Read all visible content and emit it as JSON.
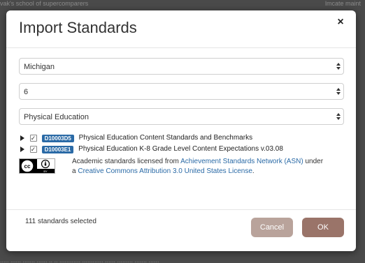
{
  "backdrop": {
    "top_left": "vak's school of supercomparers",
    "top_right": "lmcate maint",
    "bottom": "..... ...... ....... ...... .. .. ............ ............ ...... ......... ....... ......"
  },
  "modal": {
    "title": "Import Standards",
    "close_glyph": "×",
    "state_select": "Michigan",
    "grade_select": "6",
    "subject_select": "Physical Education",
    "standards": [
      {
        "code": "D10003D5",
        "label": "Physical Education Content Standards and Benchmarks",
        "checked": true
      },
      {
        "code": "D10003E1",
        "label": "Physical Education K-8 Grade Level Content Expectations v.03.08",
        "checked": true
      }
    ],
    "license": {
      "prefix": "Academic standards licensed from ",
      "asn_link": "Achievement Standards Network (ASN)",
      "middle": " under",
      "a_word": "a ",
      "cc_link": "Creative Commons Attribution 3.0 United States License",
      "suffix": "."
    },
    "selected_count": "111 standards selected",
    "cancel_label": "Cancel",
    "ok_label": "OK"
  },
  "colors": {
    "badge": "#2a6aa6",
    "link": "#2a6aa6",
    "cancel": "#b9a39b",
    "ok": "#9a7469"
  }
}
